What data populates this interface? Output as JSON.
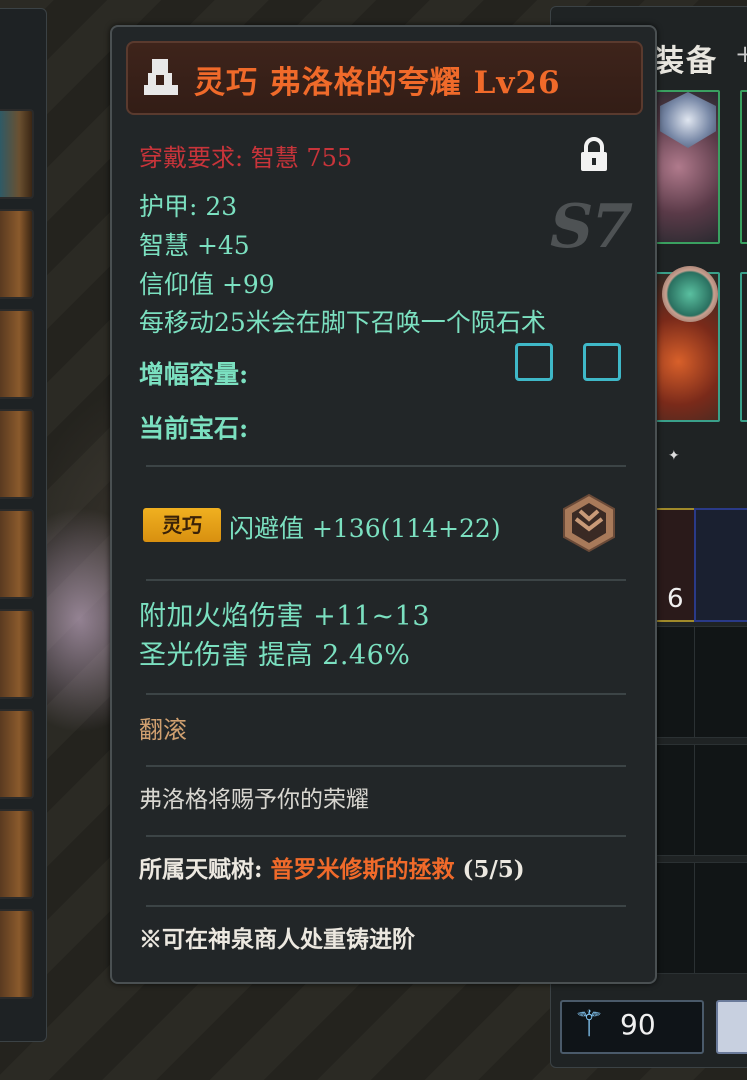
{
  "equipment_panel": {
    "title": "装备",
    "plus": "+",
    "stack_count": "6",
    "currency_value": "90"
  },
  "tooltip": {
    "title": "灵巧 弗洛格的夸耀 Lv26",
    "requirement": "穿戴要求: 智慧 755",
    "season": "S7",
    "stats": {
      "armor": "护甲: 23",
      "wisdom": "智慧 +45",
      "faith": "信仰值 +99",
      "skill": "每移动25米会在脚下召唤一个陨石术"
    },
    "amplify_label": "增幅容量:",
    "gem_label": "当前宝石:",
    "affix_badge": "灵巧",
    "dodge": "闪避值 +136(114+22)",
    "fire_damage": "附加火焰伤害 +11~13",
    "holy_damage": "圣光伤害 提高 2.46%",
    "roll": "翻滚",
    "flavor": "弗洛格将赐予你的荣耀",
    "talent_tree_label": "所属天赋树: ",
    "talent_tree_name": "普罗米修斯的拯救",
    "talent_tree_progress": " (5/5)",
    "reforge_hint": "※可在神泉商人处重铸进阶"
  },
  "colors": {
    "title": "#f06a2a",
    "requirement": "#c8343a",
    "stat": "#7be0c0",
    "badge": "#f0b020",
    "socket": "#3fb8c8"
  },
  "icons": [
    "class-icon",
    "lock-icon",
    "rank-icon",
    "wand-icon"
  ]
}
